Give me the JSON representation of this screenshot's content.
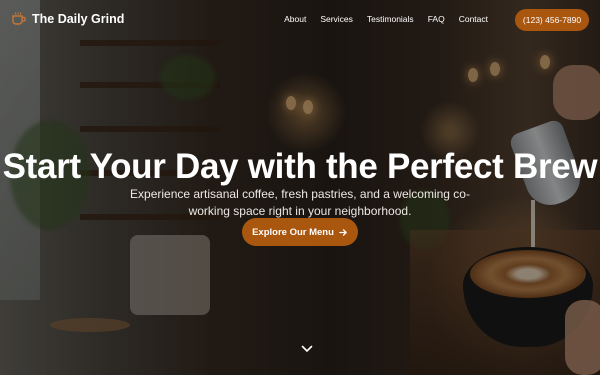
{
  "brand": {
    "name": "The Daily Grind",
    "icon": "coffee-cup-icon",
    "accent_color": "#a9560f"
  },
  "nav": {
    "links": [
      "About",
      "Services",
      "Testimonials",
      "FAQ",
      "Contact"
    ],
    "phone": "(123) 456-7890"
  },
  "hero": {
    "headline": "Start Your Day with the Perfect Brew",
    "subtitle": "Experience artisanal coffee, fresh pastries, and a welcoming co-working space right in your neighborhood.",
    "cta_label": "Explore Our Menu",
    "cta_icon": "arrow-right-icon",
    "scroll_icon": "chevron-down-icon"
  }
}
